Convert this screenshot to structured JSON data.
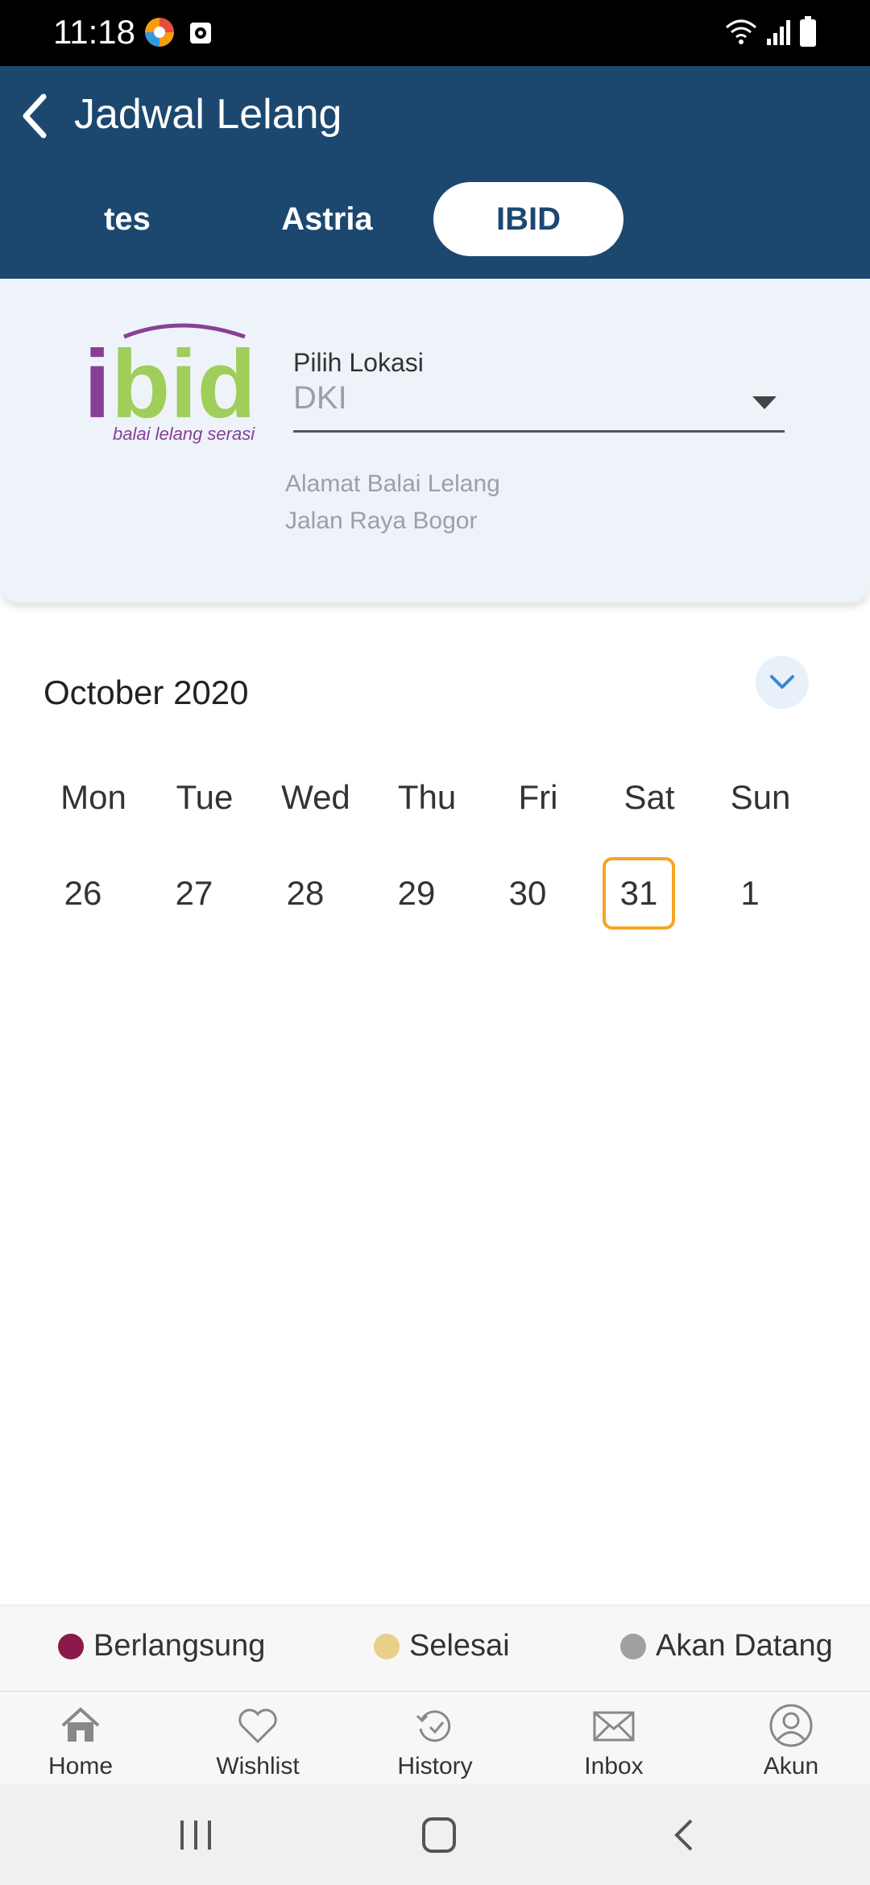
{
  "status": {
    "time": "11:18"
  },
  "header": {
    "title": "Jadwal Lelang"
  },
  "tabs": [
    {
      "label": "tes",
      "active": false
    },
    {
      "label": "Astria",
      "active": false
    },
    {
      "label": "IBID",
      "active": true
    }
  ],
  "store": {
    "logo_text": "ibid",
    "logo_tagline": "balai lelang serasi",
    "location_label": "Pilih Lokasi",
    "location_value": "DKI",
    "address_label": "Alamat Balai Lelang",
    "address_value": "Jalan Raya Bogor"
  },
  "calendar": {
    "month": "October 2020",
    "day_names": [
      "Mon",
      "Tue",
      "Wed",
      "Thu",
      "Fri",
      "Sat",
      "Sun"
    ],
    "days": [
      "26",
      "27",
      "28",
      "29",
      "30",
      "31",
      "1"
    ],
    "selected": "31"
  },
  "legend": [
    {
      "label": "Berlangsung",
      "color": "#8b1a4a"
    },
    {
      "label": "Selesai",
      "color": "#e8cf8a"
    },
    {
      "label": "Akan Datang",
      "color": "#a0a0a0"
    }
  ],
  "nav": [
    {
      "label": "Home",
      "icon": "home-icon"
    },
    {
      "label": "Wishlist",
      "icon": "heart-icon"
    },
    {
      "label": "History",
      "icon": "history-icon"
    },
    {
      "label": "Inbox",
      "icon": "envelope-icon"
    },
    {
      "label": "Akun",
      "icon": "user-icon"
    }
  ]
}
